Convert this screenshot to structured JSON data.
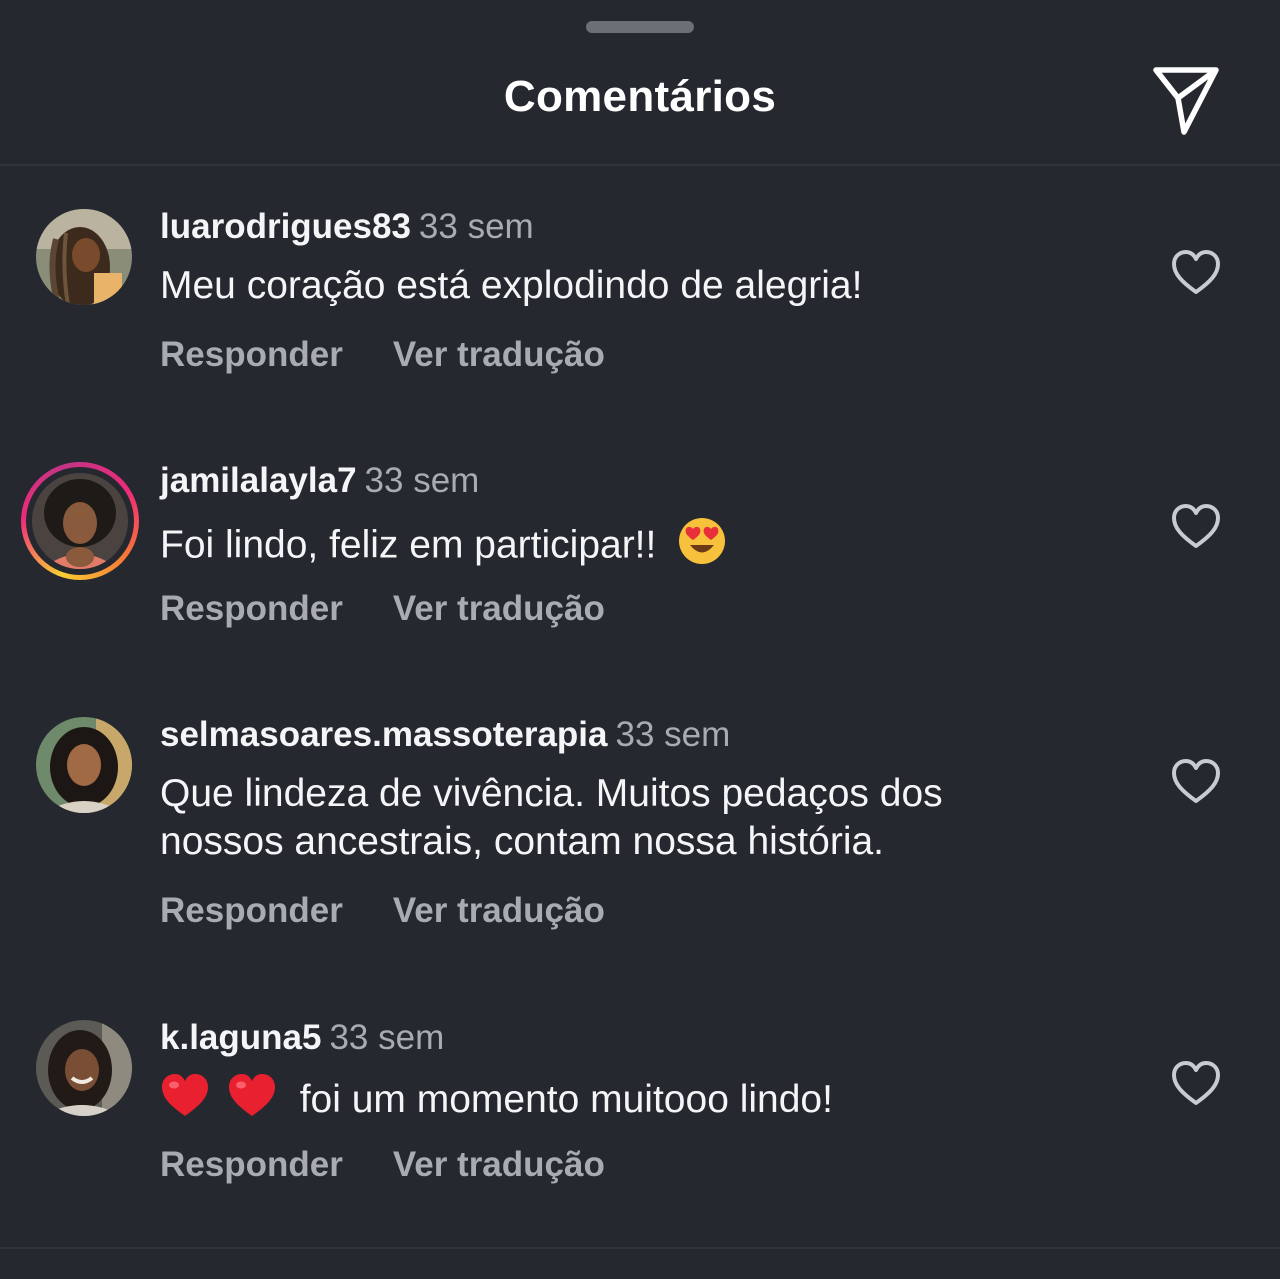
{
  "header": {
    "title": "Comentários"
  },
  "icons": {
    "share": "paper-plane-icon",
    "like": "heart-outline-icon"
  },
  "colors": {
    "background": "#25282e",
    "text_primary": "#f3f5f7",
    "text_secondary": "#a8abb1",
    "story_ring_start": "#f9ce34",
    "story_ring_mid": "#ee2a7b"
  },
  "comments": [
    {
      "username": "luarodrigues83",
      "time": "33 sem",
      "text_lines": [
        "Meu coração está explodindo de alegria!"
      ],
      "reply_label": "Responder",
      "translate_label": "Ver tradução",
      "has_story_ring": false
    },
    {
      "username": "jamilalayla7",
      "time": "33 sem",
      "text_lines": [
        "Foi lindo, feliz em participar!!"
      ],
      "emoji_after": "heart-eyes-emoji",
      "reply_label": "Responder",
      "translate_label": "Ver tradução",
      "has_story_ring": true
    },
    {
      "username": "selmasoares.massoterapia",
      "time": "33 sem",
      "text_lines": [
        "Que lindeza de vivência. Muitos pedaços dos",
        "nossos ancestrais, contam nossa história."
      ],
      "reply_label": "Responder",
      "translate_label": "Ver tradução",
      "has_story_ring": false
    },
    {
      "username": "k.laguna5",
      "time": "33 sem",
      "emoji_before": "red-heart-emoji",
      "text_lines": [
        "foi um momento muitooo lindo!"
      ],
      "reply_label": "Responder",
      "translate_label": "Ver tradução",
      "has_story_ring": false
    }
  ]
}
